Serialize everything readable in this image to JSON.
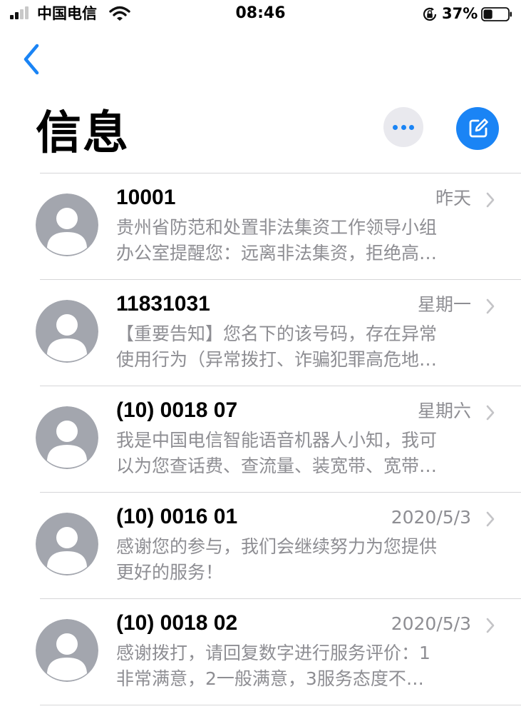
{
  "status_bar": {
    "carrier": "中国电信",
    "time": "08:46",
    "battery_percent": "37%",
    "battery_level": 0.37,
    "signal_bars_active": 2,
    "signal_bars_total": 4
  },
  "header": {
    "title": "信息"
  },
  "icons": {
    "back": "chevron-left-icon",
    "more": "ellipsis-icon",
    "compose": "compose-icon",
    "avatar": "person-icon",
    "row_chevron": "chevron-right-icon"
  },
  "colors": {
    "accent": "#1a84f5",
    "secondary_text": "#8e8e93",
    "avatar_bg": "#a3a6ae"
  },
  "conversations": [
    {
      "sender": "10001",
      "date": "昨天",
      "preview_line1": "贵州省防范和处置非法集资工作领导小组",
      "preview_line2": "办公室提醒您：远离非法集资，拒绝高…"
    },
    {
      "sender": "11831031",
      "date": "星期一",
      "preview_line1": "【重要告知】您名下的该号码，存在异常",
      "preview_line2": "使用行为（异常拨打、诈骗犯罪高危地…"
    },
    {
      "sender": "(10) 0018 07",
      "date": "星期六",
      "preview_line1": "我是中国电信智能语音机器人小知，我可",
      "preview_line2": "以为您查话费、查流量、装宽带、宽带…"
    },
    {
      "sender": "(10) 0016 01",
      "date": "2020/5/3",
      "preview_line1": "感谢您的参与，我们会继续努力为您提供",
      "preview_line2": "更好的服务！"
    },
    {
      "sender": "(10) 0018 02",
      "date": "2020/5/3",
      "preview_line1": "感谢拨打，请回复数字进行服务评价：1",
      "preview_line2": "非常满意，2一般满意，3服务态度不…"
    }
  ]
}
